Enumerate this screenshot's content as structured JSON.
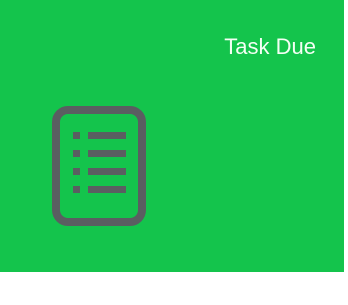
{
  "tile": {
    "title": "Task Due",
    "icon": "list-document-icon",
    "background_color": "#14c44c",
    "title_color": "#f4fff4",
    "icon_color": "#5a5e61"
  }
}
